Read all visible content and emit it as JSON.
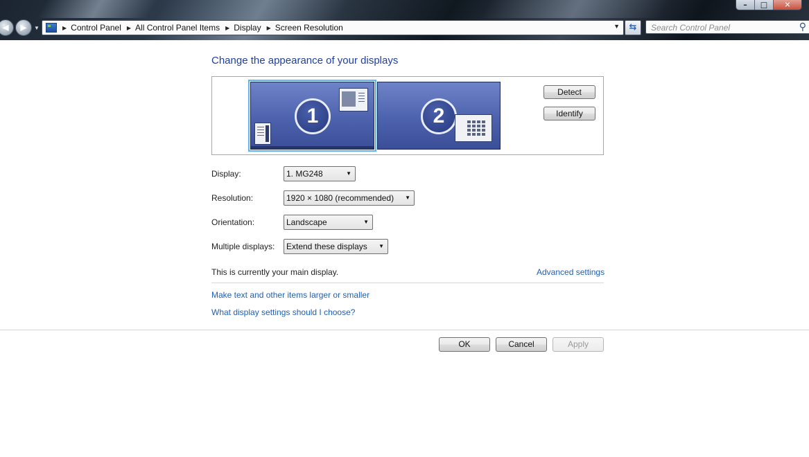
{
  "window": {
    "minimize_glyph": "–",
    "maximize_glyph": "□",
    "close_glyph": "✕"
  },
  "nav": {
    "back_icon": "back-arrow-icon",
    "forward_icon": "forward-arrow-icon"
  },
  "address_bar": {
    "icon": "control-panel-icon",
    "breadcrumbs": [
      "Control Panel",
      "All Control Panel Items",
      "Display",
      "Screen Resolution"
    ]
  },
  "search": {
    "placeholder": "Search Control Panel"
  },
  "main": {
    "heading": "Change the appearance of your displays",
    "monitors": [
      {
        "number": "1",
        "selected": true
      },
      {
        "number": "2",
        "selected": false
      }
    ],
    "detect_label": "Detect",
    "identify_label": "Identify",
    "fields": {
      "display": {
        "label": "Display:",
        "value": "1. MG248"
      },
      "resolution": {
        "label": "Resolution:",
        "value": "1920 × 1080 (recommended)"
      },
      "orientation": {
        "label": "Orientation:",
        "value": "Landscape"
      },
      "multiple": {
        "label": "Multiple displays:",
        "value": "Extend these displays"
      }
    },
    "main_display_text": "This is currently your main display.",
    "advanced_link": "Advanced settings",
    "links": [
      "Make text and other items larger or smaller",
      "What display settings should I choose?"
    ]
  },
  "footer": {
    "ok_label": "OK",
    "cancel_label": "Cancel",
    "apply_label": "Apply"
  },
  "colors": {
    "heading": "#1e3fa0",
    "link": "#1f5fb4",
    "selection": "#5fb4ee"
  }
}
